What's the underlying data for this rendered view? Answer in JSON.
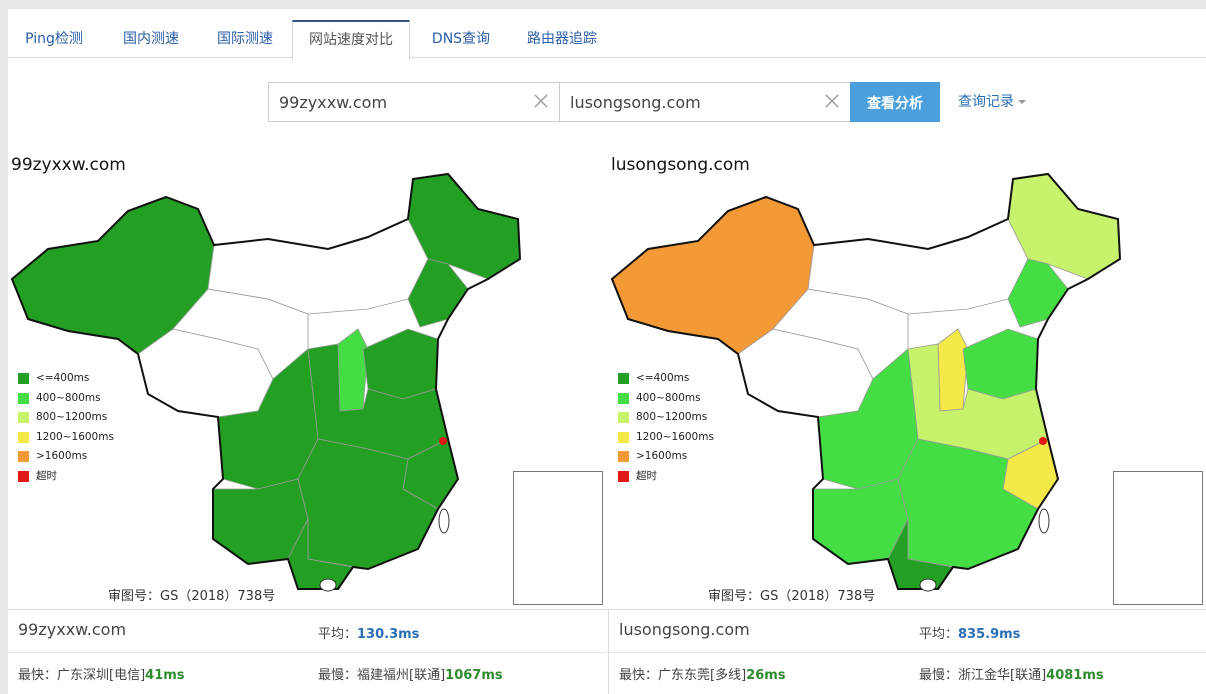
{
  "tabs": [
    {
      "label": "Ping检测",
      "active": false
    },
    {
      "label": "国内测速",
      "active": false
    },
    {
      "label": "国际测速",
      "active": false
    },
    {
      "label": "网站速度对比",
      "active": true
    },
    {
      "label": "DNS查询",
      "active": false
    },
    {
      "label": "路由器追踪",
      "active": false
    }
  ],
  "search": {
    "domain1": "99zyxxw.com",
    "domain2": "lusongsong.com",
    "analyze_label": "查看分析",
    "history_label": "查询记录"
  },
  "legend": [
    {
      "label": "<=400ms",
      "color": "#23a023"
    },
    {
      "label": "400~800ms",
      "color": "#44dd44"
    },
    {
      "label": "800~1200ms",
      "color": "#c6f36b"
    },
    {
      "label": "1200~1600ms",
      "color": "#f5e94a"
    },
    {
      "label": ">1600ms",
      "color": "#f39a37"
    },
    {
      "label": "超时",
      "color": "#e01818"
    }
  ],
  "maps": [
    {
      "title": "99zyxxw.com",
      "approval": "审图号：GS（2018）738号"
    },
    {
      "title": "lusongsong.com",
      "approval": "审图号：GS（2018）738号"
    }
  ],
  "summary": [
    {
      "domain": "99zyxxw.com",
      "avg_label": "平均：",
      "avg_value": "130.3ms",
      "fast_label": "最快：广东深圳[电信]",
      "fast_value": "41ms",
      "slow_label": "最慢：福建福州[联通]",
      "slow_value": "1067ms"
    },
    {
      "domain": "lusongsong.com",
      "avg_label": "平均：",
      "avg_value": "835.9ms",
      "fast_label": "最快：广东东莞[多线]",
      "fast_value": "26ms",
      "slow_label": "最慢：浙江金华[联通]",
      "slow_value": "4081ms"
    }
  ]
}
